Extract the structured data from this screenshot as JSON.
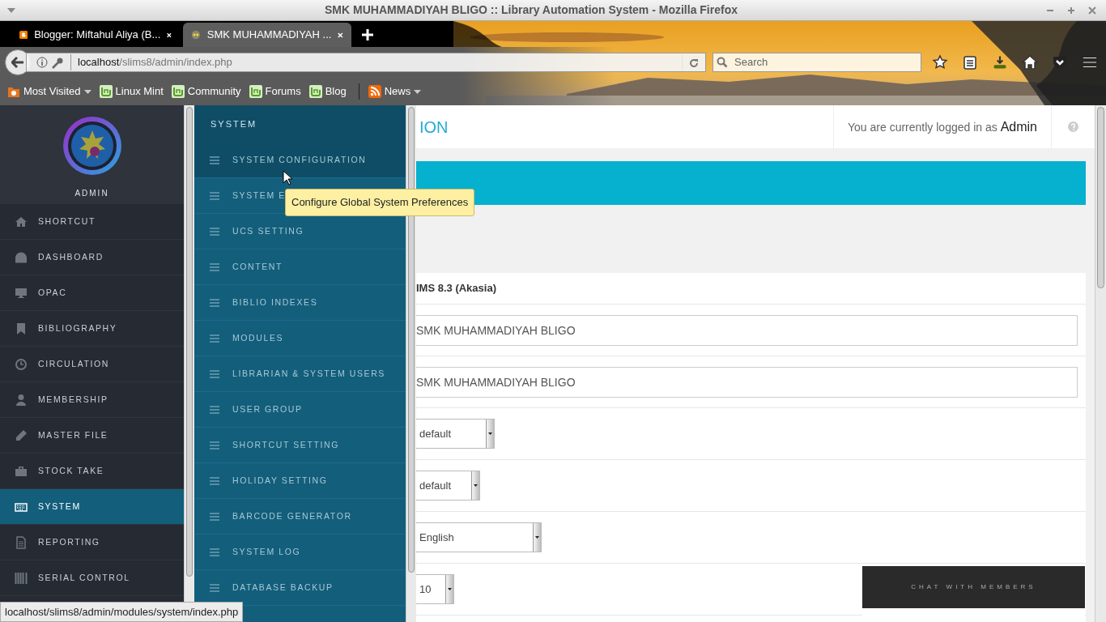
{
  "window": {
    "title": "SMK MUHAMMADIYAH BLIGO :: Library Automation System - Mozilla Firefox"
  },
  "tabs": [
    {
      "label": "Blogger: Miftahul Aliya (B...",
      "selected": false
    },
    {
      "label": "SMK MUHAMMADIYAH ...",
      "selected": true
    }
  ],
  "toolbar": {
    "url_host": "localhost",
    "url_path": "/slims8/admin/index.php",
    "search_placeholder": "Search"
  },
  "bookmarks": [
    {
      "label": "Most Visited",
      "kind": "folder"
    },
    {
      "label": "Linux Mint",
      "kind": "mint"
    },
    {
      "label": "Community",
      "kind": "mint"
    },
    {
      "label": "Forums",
      "kind": "mint"
    },
    {
      "label": "Blog",
      "kind": "mint"
    },
    {
      "label": "News",
      "kind": "feed"
    }
  ],
  "sidebar": {
    "user": "ADMIN",
    "items": [
      {
        "label": "SHORTCUT",
        "selected": false
      },
      {
        "label": "DASHBOARD",
        "selected": false
      },
      {
        "label": "OPAC",
        "selected": false
      },
      {
        "label": "BIBLIOGRAPHY",
        "selected": false
      },
      {
        "label": "CIRCULATION",
        "selected": false
      },
      {
        "label": "MEMBERSHIP",
        "selected": false
      },
      {
        "label": "MASTER FILE",
        "selected": false
      },
      {
        "label": "STOCK TAKE",
        "selected": false
      },
      {
        "label": "SYSTEM",
        "selected": true
      },
      {
        "label": "REPORTING",
        "selected": false
      },
      {
        "label": "SERIAL CONTROL",
        "selected": false
      }
    ]
  },
  "submenu": {
    "title": "SYSTEM",
    "items": [
      {
        "label": "SYSTEM CONFIGURATION",
        "hovered": true
      },
      {
        "label": "SYSTEM E",
        "hovered": false
      },
      {
        "label": "UCS SETTING",
        "hovered": false
      },
      {
        "label": "CONTENT",
        "hovered": false
      },
      {
        "label": "BIBLIO INDEXES",
        "hovered": false
      },
      {
        "label": "MODULES",
        "hovered": false
      },
      {
        "label": "LIBRARIAN & SYSTEM USERS",
        "hovered": false
      },
      {
        "label": "USER GROUP",
        "hovered": false
      },
      {
        "label": "SHORTCUT SETTING",
        "hovered": false
      },
      {
        "label": "HOLIDAY SETTING",
        "hovered": false
      },
      {
        "label": "BARCODE GENERATOR",
        "hovered": false
      },
      {
        "label": "SYSTEM LOG",
        "hovered": false
      },
      {
        "label": "DATABASE BACKUP",
        "hovered": false
      }
    ]
  },
  "tooltip": "Configure Global System Preferences",
  "header": {
    "title": "ION",
    "login": "You are currently logged in as **Admin**"
  },
  "form": {
    "rows": [
      {
        "kind": "text",
        "value": "IMS 8.3 (Akasia)"
      },
      {
        "kind": "input",
        "value": "SMK MUHAMMADIYAH BLIGO"
      },
      {
        "kind": "input",
        "value": "SMK MUHAMMADIYAH BLIGO"
      },
      {
        "kind": "select",
        "value": "default"
      },
      {
        "kind": "select",
        "value": "default"
      },
      {
        "kind": "select",
        "value": "English"
      },
      {
        "kind": "select",
        "value": "10"
      }
    ]
  },
  "chat": {
    "label": "CHAT WITH MEMBERS"
  },
  "status_bar": "localhost/slims8/admin/modules/system/index.php"
}
